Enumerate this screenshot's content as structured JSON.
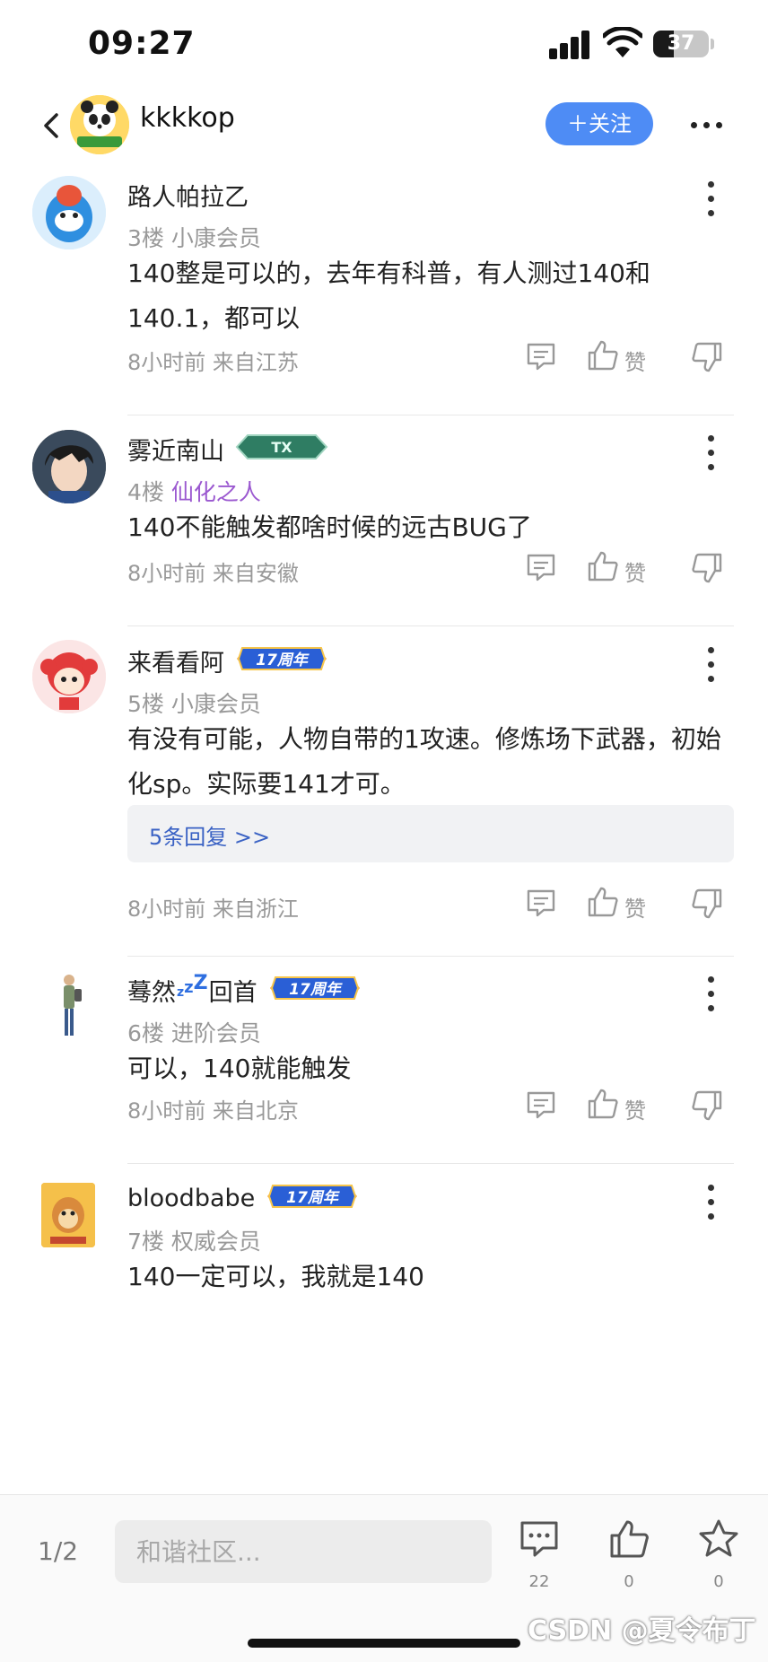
{
  "status_bar": {
    "time": "09:27",
    "battery": 37
  },
  "header": {
    "username": "kkkkop",
    "follow_label": "＋关注"
  },
  "posts": [
    {
      "username": "路人帕拉乙",
      "badge": "",
      "floor": "3楼",
      "level": "小康会员",
      "content": "140整是可以的，去年有科普，有人测过140和140.1，都可以",
      "replies": "",
      "time_location": "8小时前 来自江苏",
      "like_label": "赞"
    },
    {
      "username": "雾近南山",
      "badge": "TX",
      "floor": "4楼",
      "level": "仙化之人",
      "content": "140不能触发都啥时候的远古BUG了",
      "replies": "",
      "time_location": "8小时前 来自安徽",
      "like_label": "赞"
    },
    {
      "username": "来看看阿",
      "badge": "17周年",
      "floor": "5楼",
      "level": "小康会员",
      "content": "有没有可能，人物自带的1攻速。修炼场下武器，初始化sp。实际要141才可。",
      "replies": "5条回复 >>",
      "time_location": "8小时前 来自浙江",
      "like_label": "赞"
    },
    {
      "username": "蓦然",
      "username_suffix": "回首",
      "badge": "17周年",
      "floor": "6楼",
      "level": "进阶会员",
      "content": "可以，140就能触发",
      "replies": "",
      "time_location": "8小时前 来自北京",
      "like_label": "赞"
    },
    {
      "username": "bloodbabe",
      "badge": "17周年",
      "floor": "7楼",
      "level": "权威会员",
      "content": "140一定可以，我就是140",
      "replies": "",
      "time_location": "",
      "like_label": ""
    }
  ],
  "bottom_bar": {
    "page": "1/2",
    "input_placeholder": "和谐社区...",
    "comment_count": "22",
    "like_count": "0",
    "star_count": "0",
    "watermark": "CSDN @夏令布丁"
  },
  "colors": {
    "accent": "#4e8cf5",
    "link": "#3a62c4",
    "level_purple": "#9b59d0"
  }
}
